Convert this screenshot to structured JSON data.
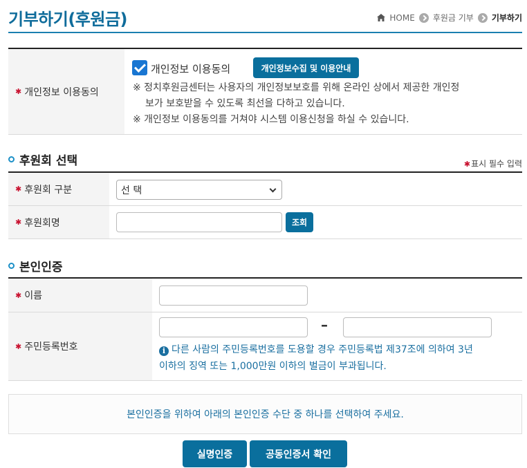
{
  "header": {
    "title": "기부하기(후원금)",
    "breadcrumb": {
      "home": "HOME",
      "parent": "후원금 기부",
      "current": "기부하기"
    }
  },
  "consent": {
    "label": "개인정보 이용동의",
    "checkbox_label": "개인정보 이용동의",
    "checked": true,
    "guide_button": "개인정보수집 및 이용안내",
    "notes": [
      "※ 정치후원금센터는 사용자의 개인정보보호를 위해 온라인 상에서 제공한 개인정",
      "보가 보호받을 수 있도록 최선을 다하고 있습니다.",
      "※ 개인정보 이용동의를 거쳐야 시스템 이용신청을 하실 수 있습니다."
    ]
  },
  "supporter_section": {
    "title": "후원회 선택",
    "required_note": "표시 필수 입력",
    "type_label": "후원회 구분",
    "type_selected": "선 택",
    "name_label": "후원회명",
    "name_value": "",
    "search_button": "조회"
  },
  "identity_section": {
    "title": "본인인증",
    "name_label": "이름",
    "name_value": "",
    "rrn_label": "주민등록번호",
    "rrn_front": "",
    "rrn_back": "",
    "rrn_separator": "–",
    "warning_lines": [
      "다른 사람의 주민등록번호를 도용할 경우 주민등록법 제37조에 의하여 3년",
      "이하의 징역 또는 1,000만원 이하의 벌금이 부과됩니다."
    ]
  },
  "auth": {
    "message": "본인인증을 위하여 아래의 본인인증 수단 중 하나를 선택하여 주세요.",
    "real_name_button": "실명인증",
    "certificate_button": "공동인증서 확인"
  },
  "colors": {
    "primary": "#0a6f9d",
    "title": "#0f6c9b",
    "required": "#c8102e",
    "checkbox": "#1976d2",
    "info": "#1a6fa0"
  }
}
